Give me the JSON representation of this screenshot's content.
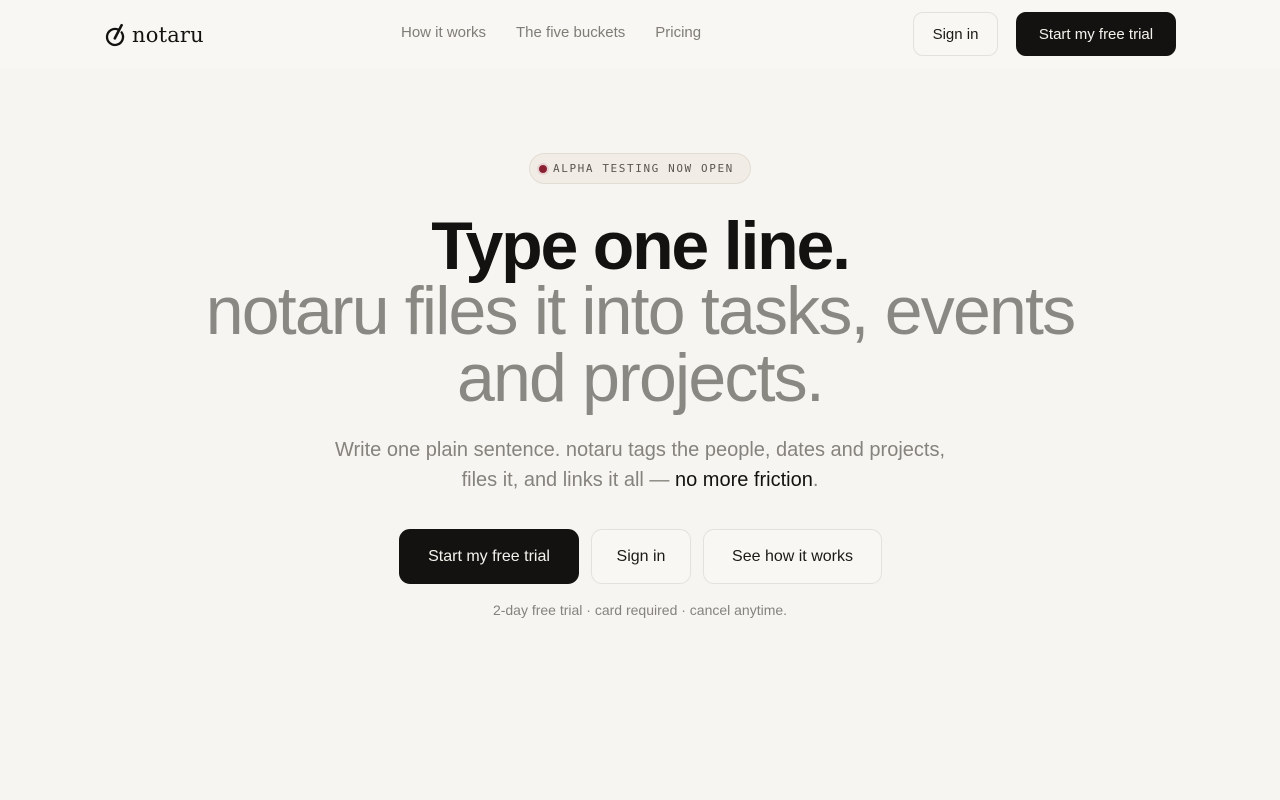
{
  "header": {
    "logo_text": "notaru",
    "logo_icon": "notaru-logo-icon",
    "nav": [
      {
        "label": "How it works"
      },
      {
        "label": "The five buckets"
      },
      {
        "label": "Pricing"
      }
    ],
    "sign_in_label": "Sign in",
    "trial_label": "Start my free trial"
  },
  "hero": {
    "badge_text": "ALPHA TESTING NOW OPEN",
    "headline": "Type one line.",
    "subheadline": "notaru files it into tasks, events and projects.",
    "description_lead": "Write one plain sentence. notaru tags the people, dates and projects, files it, and links it all — ",
    "description_emphasis": "no more friction",
    "description_tail": ".",
    "cta_primary": "Start my free trial",
    "cta_sign_in": "Sign in",
    "cta_how": "See how it works",
    "fine_print": "2-day free trial · card required · cancel anytime."
  },
  "colors": {
    "background": "#f6f5f1",
    "primary_button": "#141210",
    "badge_dot": "#8a2133",
    "muted_text": "#86837d"
  }
}
